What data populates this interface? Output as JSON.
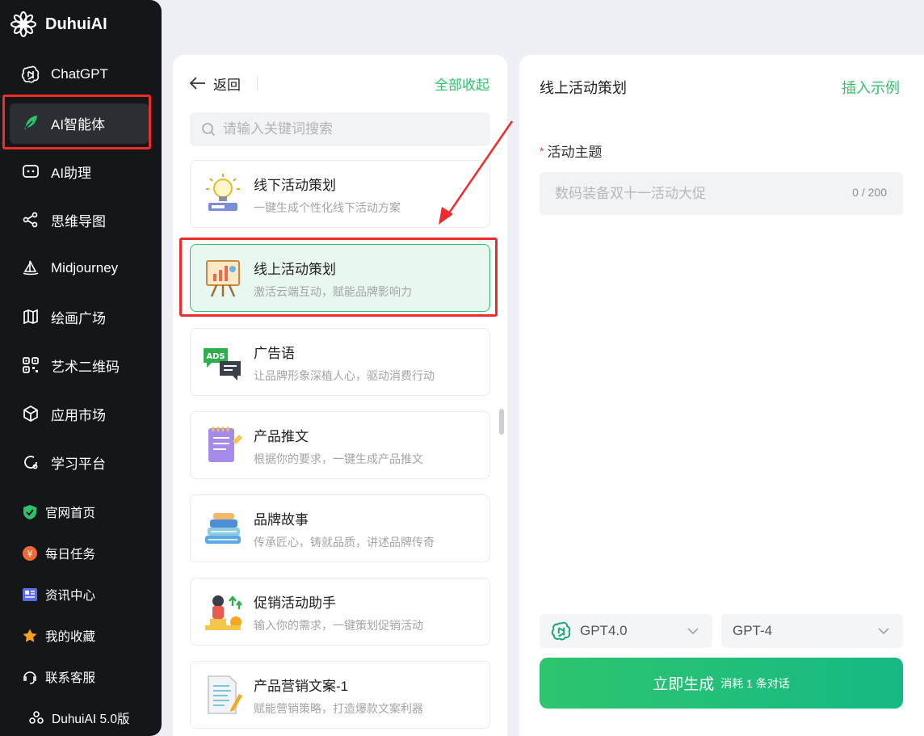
{
  "brand": {
    "name": "DuhuiAI"
  },
  "nav": [
    {
      "label": "ChatGPT",
      "icon": "openai-icon"
    },
    {
      "label": "AI智能体",
      "icon": "feather-icon",
      "active": true
    },
    {
      "label": "AI助理",
      "icon": "robot-icon"
    },
    {
      "label": "思维导图",
      "icon": "mindmap-icon"
    },
    {
      "label": "Midjourney",
      "icon": "sailboat-icon"
    },
    {
      "label": "绘画广场",
      "icon": "map-icon"
    },
    {
      "label": "艺术二维码",
      "icon": "qrcode-icon"
    },
    {
      "label": "应用市场",
      "icon": "cube-icon"
    },
    {
      "label": "学习平台",
      "icon": "learning-icon"
    }
  ],
  "sub_nav": [
    {
      "label": "官网首页",
      "icon": "shield-check-icon"
    },
    {
      "label": "每日任务",
      "icon": "coin-icon"
    },
    {
      "label": "资讯中心",
      "icon": "news-icon"
    },
    {
      "label": "我的收藏",
      "icon": "star-icon"
    },
    {
      "label": "联系客服",
      "icon": "headset-icon"
    }
  ],
  "version": {
    "label": "DuhuiAI 5.0版"
  },
  "mid": {
    "back_label": "返回",
    "collapse_all": "全部收起",
    "search_placeholder": "请输入关键词搜索",
    "cards": [
      {
        "title": "线下活动策划",
        "desc": "一键生成个性化线下活动方案",
        "icon": "lightbulb-icon"
      },
      {
        "title": "线上活动策划",
        "desc": "激活云端互动，赋能品牌影响力",
        "icon": "presentation-board-icon",
        "selected": true
      },
      {
        "title": "广告语",
        "desc": "让品牌形象深植人心，驱动消费行动",
        "icon": "ads-chat-icon"
      },
      {
        "title": "产品推文",
        "desc": "根据你的要求，一键生成产品推文",
        "icon": "notepad-icon"
      },
      {
        "title": "品牌故事",
        "desc": "传承匠心，铸就品质，讲述品牌传奇",
        "icon": "books-icon"
      },
      {
        "title": "促销活动助手",
        "desc": "输入你的需求，一键策划促销活动",
        "icon": "promo-icon"
      },
      {
        "title": "产品营销文案-1",
        "desc": "赋能营销策略，打造爆款文案利器",
        "icon": "document-pen-icon"
      }
    ]
  },
  "right": {
    "title": "线上活动策划",
    "insert_example": "插入示例",
    "field_label": "活动主题",
    "required_mark": "*",
    "field_placeholder": "数码装备双十一活动大促",
    "char_count": "0 / 200",
    "model_select": "GPT4.0",
    "version_select": "GPT-4",
    "generate_label": "立即生成",
    "generate_cost": "消耗 1 条对话"
  },
  "colors": {
    "accent": "#2fc26b",
    "sidebar": "#141619",
    "annotation": "#ef2b2b"
  }
}
